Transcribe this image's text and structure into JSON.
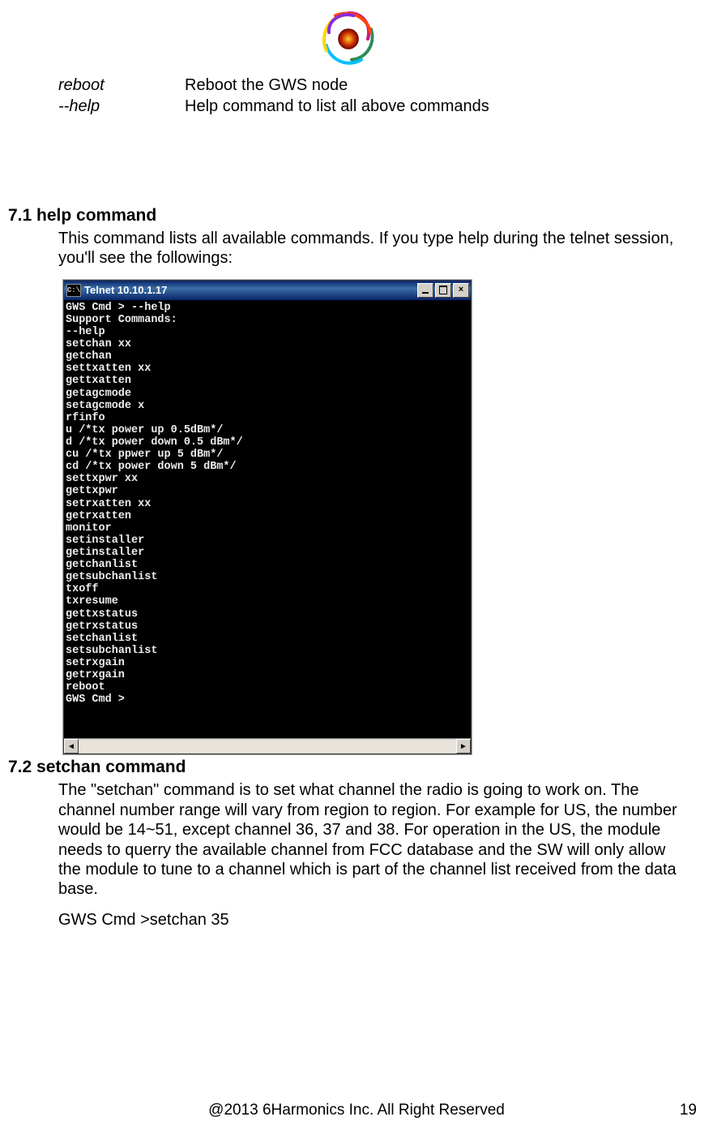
{
  "commands_table": {
    "rows": [
      {
        "cmd": "reboot",
        "desc": "Reboot the GWS  node"
      },
      {
        "cmd": "--help",
        "desc": "Help command to list all above commands"
      }
    ]
  },
  "section_71": {
    "heading": "7.1 help command",
    "para": "This command lists all available commands.  If you type help during the telnet session, you'll see the followings:"
  },
  "telnet": {
    "title": "Telnet 10.10.1.17",
    "icon_text": "C:\\",
    "btn_close": "×",
    "lines": [
      "GWS Cmd > --help",
      "Support Commands:",
      "--help",
      "setchan xx",
      "getchan",
      "settxatten xx",
      "gettxatten",
      "getagcmode",
      "setagcmode x",
      "rfinfo",
      "u /*tx power up 0.5dBm*/",
      "d /*tx power down 0.5 dBm*/",
      "cu /*tx ppwer up 5 dBm*/",
      "cd /*tx power down 5 dBm*/",
      "settxpwr xx",
      "gettxpwr",
      "setrxatten xx",
      "getrxatten",
      "monitor",
      "setinstaller",
      "getinstaller",
      "getchanlist",
      "getsubchanlist",
      "txoff",
      "txresume",
      "gettxstatus",
      "getrxstatus",
      "setchanlist",
      "setsubchanlist",
      "setrxgain",
      "getrxgain",
      "reboot",
      "GWS Cmd >"
    ],
    "scroll_left": "◄",
    "scroll_right": "►"
  },
  "section_72": {
    "heading": "7.2  setchan command",
    "para": "The \"setchan\" command is to set what channel the radio is going to work on.  The channel number range will vary from region to region. For example for US, the number would be 14~51, except channel 36, 37 and 38.   For operation in the US, the module needs to querry the available channel from FCC database and the SW will only allow the module to tune to a channel which is part of the channel list received from the data base.",
    "cmdline": "GWS Cmd >setchan  35"
  },
  "footer": "@2013 6Harmonics Inc. All Right Reserved",
  "page_number": "19"
}
